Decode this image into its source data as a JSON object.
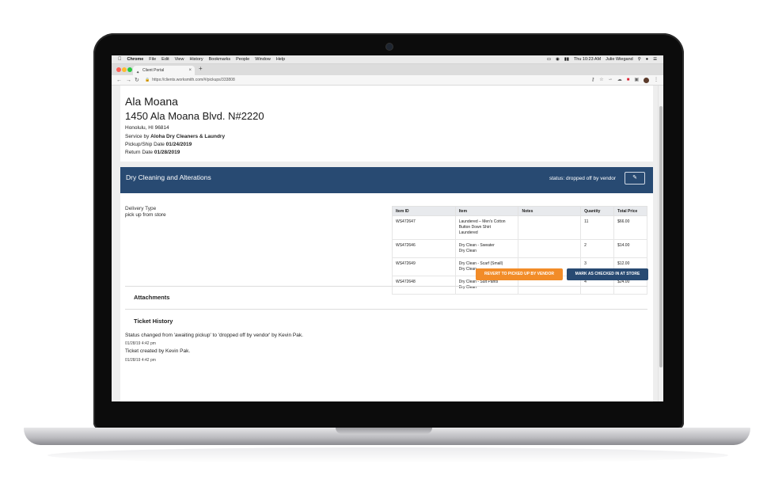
{
  "menubar": {
    "app": "Chrome",
    "menus": [
      "File",
      "Edit",
      "View",
      "History",
      "Bookmarks",
      "People",
      "Window",
      "Help"
    ],
    "clock": "Thu 10:23 AM",
    "user": "Julie Wiegand"
  },
  "browser": {
    "tab_title": "Client Portal",
    "url": "https://clients.worksmith.com/#/pickups/333808"
  },
  "location": {
    "name": "Ala Moana",
    "address": "1450 Ala Moana Blvd. N#2220",
    "city": "Honolulu, HI 96814",
    "service_prefix": "Service by ",
    "service_vendor": "Aloha Dry Cleaners & Laundry",
    "pickup_label": "Pickup/Ship Date ",
    "pickup_date": "01/24/2019",
    "return_label": "Return Date ",
    "return_date": "01/28/2019"
  },
  "banner": {
    "title": "Dry Cleaning and Alterations",
    "status": "status: dropped off by vendor"
  },
  "delivery": {
    "label": "Delivery Type",
    "value": "pick up from store"
  },
  "table": {
    "headers": [
      "Item ID",
      "Item",
      "Notes",
      "Quantity",
      "Total Price"
    ],
    "rows": [
      {
        "id": "WS472647",
        "item_l1": "Laundered – Men's Cotton",
        "item_l2": "Button Down Shirt",
        "item_l3": "Laundered",
        "notes": "",
        "qty": "11",
        "price": "$66.00"
      },
      {
        "id": "WS472646",
        "item_l1": "Dry Clean - Sweater",
        "item_l2": "Dry Clean",
        "notes": "",
        "qty": "2",
        "price": "$14.00"
      },
      {
        "id": "WS472649",
        "item_l1": "Dry Clean - Scarf (Small)",
        "item_l2": "Dry Clean",
        "notes": "",
        "qty": "3",
        "price": "$12.00"
      },
      {
        "id": "WS472648",
        "item_l1": "Dry Clean - Suit Pants",
        "item_l2": "Dry Clean",
        "notes": "",
        "qty": "4",
        "price": "$24.00"
      }
    ]
  },
  "actions": {
    "revert": "REVERT TO PICKED UP BY VENDOR",
    "mark": "MARK AS CHECKED IN AT STORE"
  },
  "attachments": {
    "heading": "Attachments"
  },
  "history": {
    "heading": "Ticket History",
    "entries": [
      {
        "text": "Status changed from 'awaiting pickup' to 'dropped off by vendor' by Kevin Pak.",
        "time": "01/28/19 4:42 pm"
      },
      {
        "text": "Ticket created by Kevin Pak.",
        "time": "01/28/19 4:42 pm"
      }
    ]
  },
  "colors": {
    "brand_navy": "#284a72",
    "action_orange": "#f28c28"
  }
}
